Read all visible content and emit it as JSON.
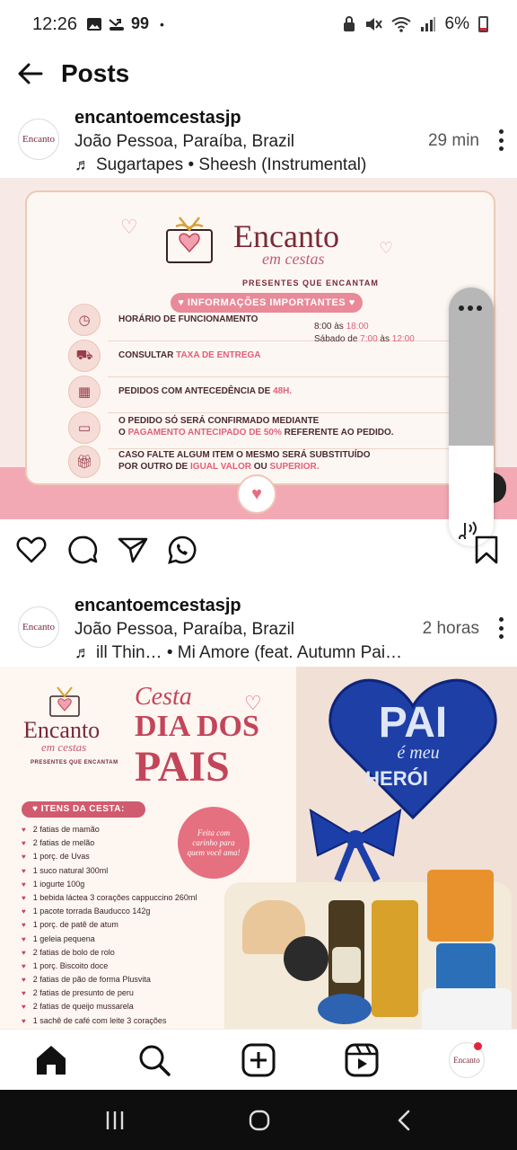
{
  "status": {
    "time": "12:26",
    "notif_count": "99",
    "battery": "6%"
  },
  "header": {
    "title": "Posts"
  },
  "posts": [
    {
      "username": "encantoemcestasjp",
      "location": "João Pessoa, Paraíba, Brazil",
      "music": "Sugartapes • Sheesh (Instrumental)",
      "ago": "29 min",
      "image": {
        "brand_name": "Encanto",
        "brand_sub": "em cestas",
        "brand_tag": "PRESENTES QUE ENCANTAM",
        "pill": "INFORMAÇÕES IMPORTANTES",
        "rows": [
          {
            "text": "HORÁRIO DE FUNCIONAMENTO",
            "icon": "clock-icon"
          },
          {
            "text": "CONSULTAR ",
            "hl": "TAXA DE ENTREGA",
            "icon": "truck-icon"
          },
          {
            "text": "PEDIDOS COM ANTECEDÊNCIA DE ",
            "hl": "48H.",
            "icon": "calendar-icon"
          },
          {
            "text": "O PEDIDO SÓ SERÁ CONFIRMADO MEDIANTE",
            "text2a": "O ",
            "hl": "PAGAMENTO ANTECIPADO DE 50%",
            "text2b": " REFERENTE AO PEDIDO.",
            "icon": "card-icon"
          },
          {
            "text": "CASO FALTE ALGUM ITEM O MESMO SERÁ SUBSTITUÍDO",
            "text2a": "POR OUTRO DE ",
            "hl": "IGUAL VALOR",
            "text2b": " OU ",
            "hl2": "SUPERIOR.",
            "icon": "gift-icon"
          }
        ],
        "hours_line1_a": "8:00 às ",
        "hours_line1_b": "18:00",
        "hours_line2_a": "Sábado de ",
        "hours_line2_b": "7:00",
        "hours_line2_c": " às ",
        "hours_line2_d": "12:00"
      }
    },
    {
      "username": "encantoemcestasjp",
      "location": "João Pessoa, Paraíba, Brazil",
      "music": "ill Thin…   • Mi Amore (feat. Autumn Pai…",
      "ago": "2 horas",
      "image": {
        "brand_name": "Encanto",
        "brand_sub": "em cestas",
        "brand_tag": "PRESENTES QUE ENCANTAM",
        "cesta": "Cesta",
        "dia": "DIA DOS",
        "pais": "PAIS",
        "itens_title": "ITENS DA CESTA:",
        "badge": "Feita com carinho para quem você ama!",
        "balloon_pai": "PAI",
        "balloon_sub": "é meu",
        "balloon_heroi": "HERÓI",
        "items": [
          "2 fatias de mamão",
          "2 fatias de melão",
          "1 porç. de Uvas",
          "1 suco natural 300ml",
          "1 iogurte 100g",
          "1 bebida láctea 3 corações cappuccino 260ml",
          "1 pacote torrada Bauducco 142g",
          "1 porç. de patê de atum",
          "1 geleia pequena",
          "2 fatias de bolo de rolo",
          "1 porç. Biscoito doce",
          "2 fatias de pão de forma Plusvita",
          "2 fatias de presunto de peru",
          "2 fatias de queijo mussarela",
          "1 sachê de café com leite 3 corações"
        ]
      }
    }
  ],
  "colors": {
    "accent": "#e5707f",
    "brand": "#7a2a36",
    "band": "#f3a9b4"
  }
}
